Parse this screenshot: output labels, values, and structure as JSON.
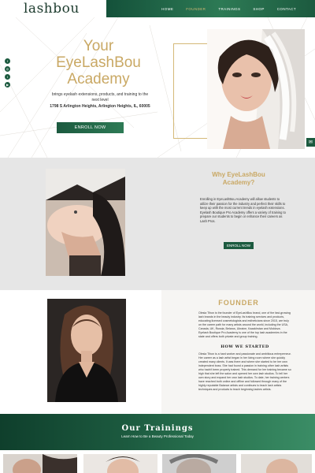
{
  "header": {
    "logo": "lashbou",
    "nav": [
      {
        "label": "HOME",
        "active": false
      },
      {
        "label": "FOUNDER",
        "active": true
      },
      {
        "label": "TRAININGS",
        "active": false
      },
      {
        "label": "SHOP",
        "active": false
      },
      {
        "label": "CONTACT",
        "active": false
      }
    ]
  },
  "social": [
    "facebook-icon",
    "instagram-icon",
    "twitter-icon",
    "youtube-icon"
  ],
  "hero": {
    "title_line1": "Your",
    "title_line2": "EyeLashBou",
    "title_line3": "Academy",
    "description": "brings eyelash extensions, products, and training to the next level",
    "address": "1798 S Arlington Heights, Arlington Heights, IL, 60005",
    "cta": "ENROLL NOW"
  },
  "why": {
    "title_line1": "Why EyeLashBou",
    "title_line2": "Academy?",
    "body": "Enrolling in EyeLashBou Academy will allow students to utilize their passion for the industry and perfect their skills to keep up with the most current trends in eyelash extensions. Eyelash Boutique Pro Academy offers a variety of training to prepare our students to begin or enhance their careers as Lash Pros.",
    "cta": "ENROLL NOW"
  },
  "founder": {
    "title": "FOUNDER",
    "body1": "Olesia Tihon is the founder of EyeLashBou brand, one of the fast-growing lash brands in the beauty industry. Its training services and products, educating licensed cosmetologists and estheticians since 2015, are truly on the career path for many artists around the world, including the USA, Canada, UK, Russia, Belarus, Ukraine, Kazakhstan and Moldova. Eyelash Boutique Pro Academy is one of the top lash academies in the state and offers both private and group training.",
    "subtitle": "HOW WE STARTED",
    "body2": "Olesia Tihon is a hard worker and passionate and ambitious entrepreneur. Her career as a lash artist began in her living room where she quickly created many clients. It was there and where she started to be her own independent boss. She had found a passion in training other lash artists who hadn't been properly trained. This demand for her training became so high that she left the salon and opened her own lash studios. To tell her own story and expand her own lash studios. To date, her training centers have reached both online and offline and followed through many of the highly reputable Balance artists and continues to teach lash artists techniques and products to teach beginning lashes artists."
  },
  "trainings": {
    "title": "Our Trainings",
    "subtitle": "Learn How to Be a Beauty Professional Today"
  },
  "chat": {
    "icon": "chat-icon"
  }
}
